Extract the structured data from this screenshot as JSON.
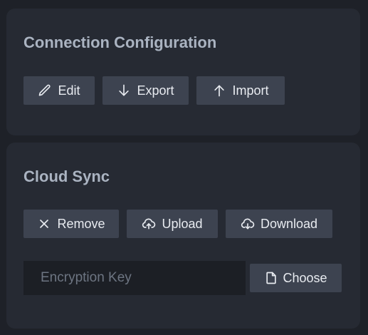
{
  "connection": {
    "title": "Connection Configuration",
    "buttons": {
      "edit": {
        "label": "Edit",
        "icon": "pencil-icon"
      },
      "export": {
        "label": "Export",
        "icon": "arrow-down-icon"
      },
      "import": {
        "label": "Import",
        "icon": "arrow-up-icon"
      }
    }
  },
  "cloud_sync": {
    "title": "Cloud Sync",
    "buttons": {
      "remove": {
        "label": "Remove",
        "icon": "close-icon"
      },
      "upload": {
        "label": "Upload",
        "icon": "cloud-upload-icon"
      },
      "download": {
        "label": "Download",
        "icon": "cloud-download-icon"
      }
    },
    "encryption_key": {
      "placeholder": "Encryption Key",
      "value": ""
    },
    "choose": {
      "label": "Choose",
      "icon": "file-icon"
    }
  },
  "colors": {
    "background": "#1e2128",
    "card": "#262a33",
    "button": "#3d4350",
    "title": "#aab3c1",
    "text": "#e8ebf0",
    "input_bg": "#1c1f25",
    "placeholder": "#6d7582"
  }
}
